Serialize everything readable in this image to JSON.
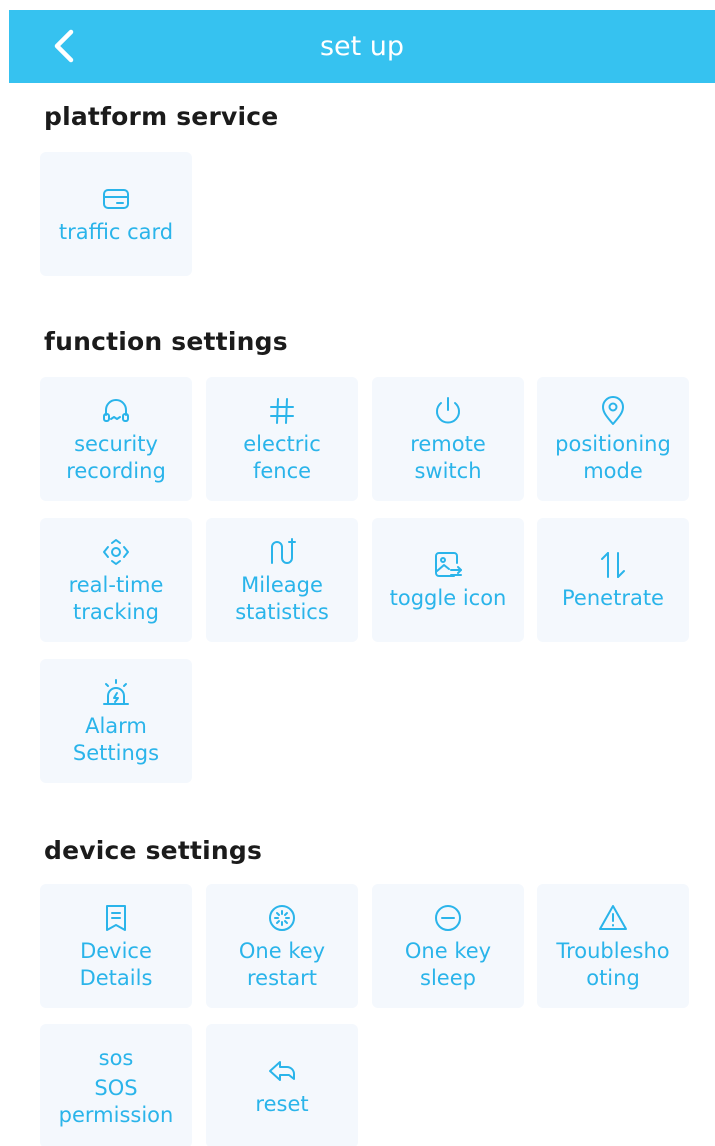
{
  "header": {
    "title": "set up",
    "back_label": "back"
  },
  "sections": {
    "platform": {
      "title": "platform service"
    },
    "function": {
      "title": "function settings"
    },
    "device": {
      "title": "device settings"
    }
  },
  "platform_items": [
    {
      "label": "traffic card",
      "icon": "card-icon"
    }
  ],
  "function_items": [
    {
      "label": "security\nrecording",
      "icon": "headset-icon"
    },
    {
      "label": "electric\nfence",
      "icon": "hash-icon"
    },
    {
      "label": "remote\nswitch",
      "icon": "power-icon"
    },
    {
      "label": "positioning\nmode",
      "icon": "location-pin-icon"
    },
    {
      "label": "real-time\ntracking",
      "icon": "tracking-icon"
    },
    {
      "label": "Mileage\nstatistics",
      "icon": "route-icon"
    },
    {
      "label": "toggle icon",
      "icon": "image-swap-icon"
    },
    {
      "label": "Penetrate",
      "icon": "up-down-arrows-icon"
    },
    {
      "label": "Alarm\nSettings",
      "icon": "siren-icon"
    }
  ],
  "device_items": [
    {
      "label": "Device\nDetails",
      "icon": "bookmark-doc-icon"
    },
    {
      "label": "One key\nrestart",
      "icon": "restart-icon"
    },
    {
      "label": "One key\nsleep",
      "icon": "minus-circle-icon"
    },
    {
      "label": "Troublesho\noting",
      "icon": "warning-triangle-icon"
    },
    {
      "label": "SOS\npermission",
      "icon_text": "sos",
      "icon": "sos-icon"
    },
    {
      "label": "reset",
      "icon": "reset-arrow-icon"
    }
  ],
  "colors": {
    "header_bg": "#36c2f0",
    "accent": "#2ab4ea",
    "tile_bg": "#f4f8fd",
    "section_text": "#1b1b1b"
  }
}
